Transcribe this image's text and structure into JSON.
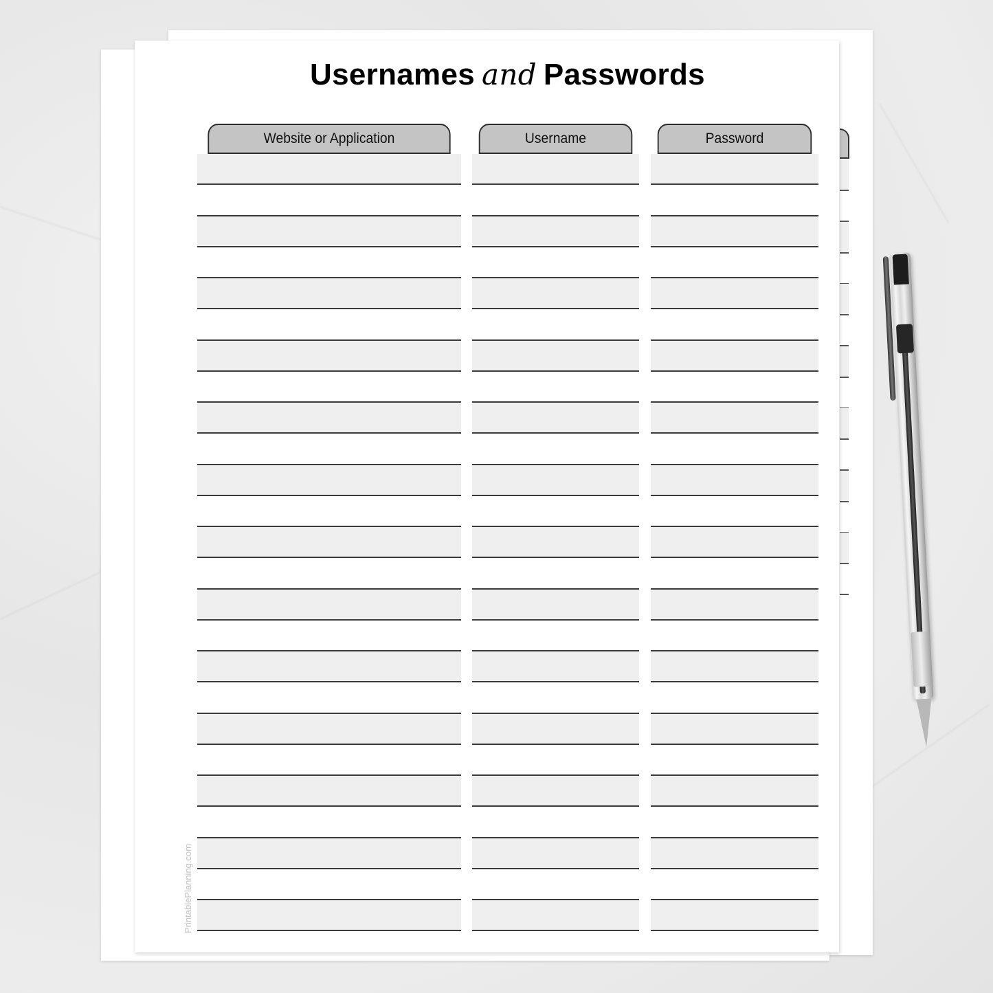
{
  "document": {
    "title_part1": "Usernames",
    "title_connector": "and",
    "title_part2": "Passwords",
    "watermark": "PrintablePlanning.com",
    "columns": [
      {
        "label": "Website or Application"
      },
      {
        "label": "Username"
      },
      {
        "label": "Password"
      }
    ],
    "row_count": 25,
    "rows_pattern": "alternating shaded/white, starting shaded"
  },
  "colors": {
    "header_fill": "#c4c4c4",
    "shaded_row": "#efefef",
    "rule_line": "#3a3a3a"
  },
  "scene": {
    "objects": [
      "stacked-paper-sheets",
      "gel-pen",
      "marble-surface"
    ]
  }
}
